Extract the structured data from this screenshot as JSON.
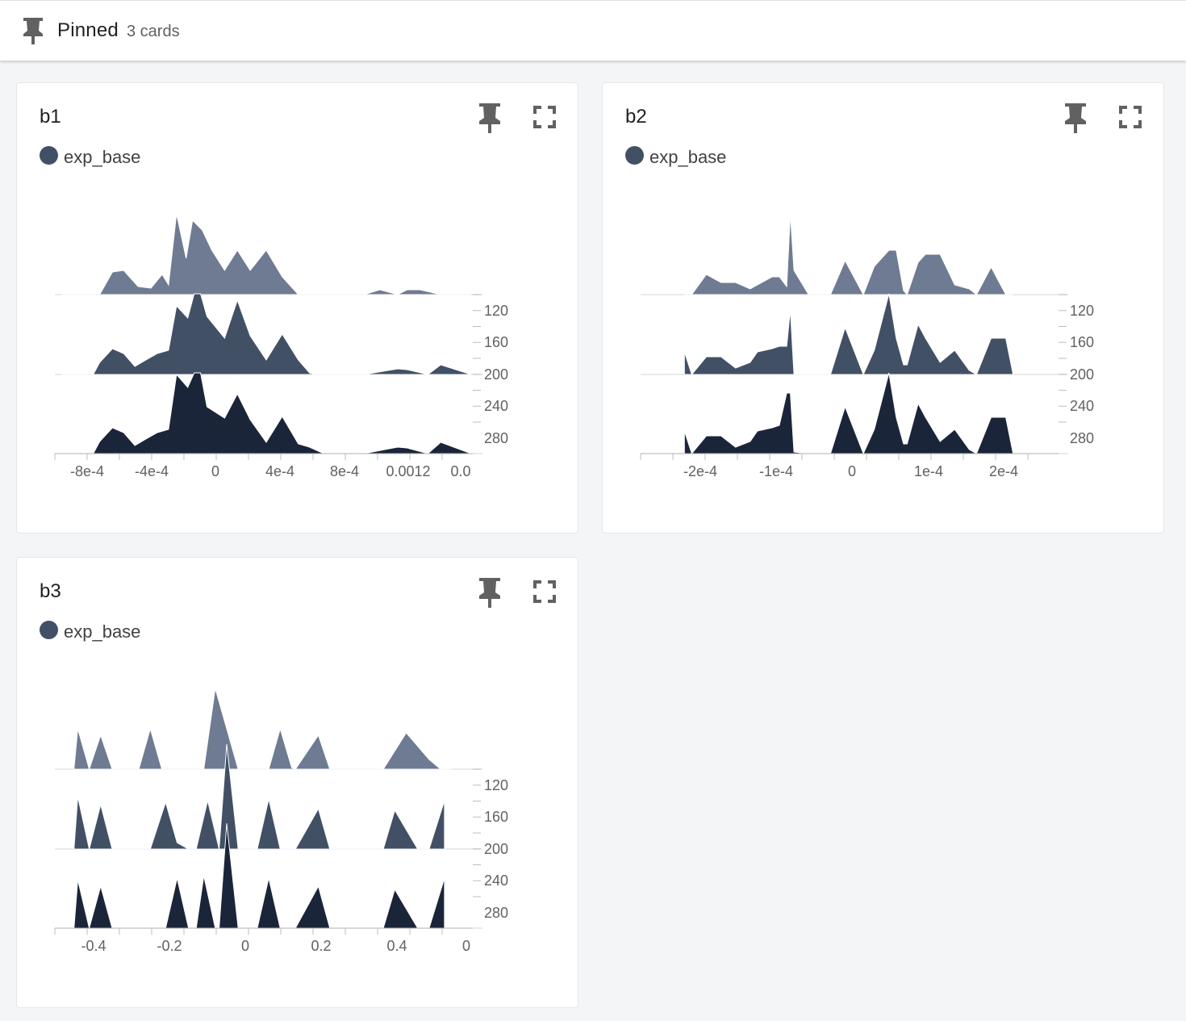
{
  "header": {
    "title": "Pinned",
    "count": "3 cards",
    "icon": "pin-icon"
  },
  "colors": {
    "series": [
      "#6e7b92",
      "#425066",
      "#1b2539"
    ],
    "legend_dot": "#425066"
  },
  "cards": [
    {
      "title": "b1",
      "legend": "exp_base",
      "chart_data": {
        "type": "area",
        "subtype": "histogram-offset",
        "x_ticks": [
          "-8e-4",
          "-4e-4",
          "0",
          "4e-4",
          "8e-4",
          "0.0012",
          "0.0"
        ],
        "y_ticks": [
          "120",
          "160",
          "200",
          "240",
          "280"
        ],
        "series": [
          {
            "x": [
              -0.00096,
              -0.00072,
              -0.00064,
              -0.00057,
              -0.00048,
              -0.0004,
              -0.00033,
              -0.00029,
              -0.00024,
              -0.00018,
              -0.00014,
              -8e-05,
              -2e-05,
              6e-05,
              0.00014,
              0.00022,
              0.00032,
              0.00042,
              0.00052,
              0.00059,
              0.00063,
              0.00093,
              0.00103,
              0.00114,
              0.0012,
              0.00128,
              0.00141,
              0.00143,
              0.0016
            ],
            "y": [
              0,
              0,
              0.28,
              0.3,
              0.1,
              0.08,
              0.25,
              0.12,
              1.0,
              0.45,
              0.92,
              0.8,
              0.55,
              0.3,
              0.55,
              0.3,
              0.55,
              0.22,
              0.0,
              0,
              0,
              0,
              0.06,
              0.0,
              0.06,
              0.06,
              0.0,
              0,
              0
            ]
          },
          {
            "x": [
              -0.00096,
              -0.00076,
              -0.00072,
              -0.00064,
              -0.00057,
              -0.0005,
              -0.00044,
              -0.00036,
              -0.00029,
              -0.00024,
              -0.00017,
              -0.00013,
              -9e-05,
              -5e-05,
              6e-05,
              0.00014,
              0.00022,
              0.00032,
              0.00042,
              0.00052,
              0.00059,
              0.00063,
              0.00093,
              0.00114,
              0.0012,
              0.00133,
              0.00141,
              0.0016
            ],
            "y": [
              0,
              0,
              0.15,
              0.32,
              0.26,
              0.1,
              0.17,
              0.26,
              0.3,
              0.85,
              0.7,
              1.0,
              1.0,
              0.72,
              0.45,
              0.92,
              0.48,
              0.18,
              0.5,
              0.18,
              0.02,
              0,
              0,
              0.07,
              0.06,
              0.0,
              0.12,
              0
            ],
            "y_offset": 1
          },
          {
            "x": [
              -0.00096,
              -0.00076,
              -0.00072,
              -0.00064,
              -0.00057,
              -0.0005,
              -0.00044,
              -0.00036,
              -0.00029,
              -0.00024,
              -0.00017,
              -0.00013,
              -9e-05,
              -5e-05,
              6e-05,
              0.00014,
              0.00022,
              0.00032,
              0.00042,
              0.00052,
              0.00059,
              0.00068,
              0.00093,
              0.00114,
              0.0012,
              0.00133,
              0.00141,
              0.0016
            ],
            "y": [
              0,
              0,
              0.15,
              0.32,
              0.26,
              0.1,
              0.17,
              0.26,
              0.3,
              0.98,
              0.82,
              1.0,
              1.0,
              0.58,
              0.44,
              0.74,
              0.42,
              0.14,
              0.46,
              0.12,
              0.08,
              0.0,
              0,
              0.08,
              0.07,
              0.0,
              0.14,
              0
            ],
            "y_offset": 2
          }
        ],
        "x_range": [
          -0.001,
          0.0016
        ]
      }
    },
    {
      "title": "b2",
      "legend": "exp_base",
      "chart_data": {
        "type": "area",
        "subtype": "histogram-offset",
        "x_ticks": [
          "-2e-4",
          "-1e-4",
          "0",
          "1e-4",
          "2e-4"
        ],
        "y_ticks": [
          "120",
          "160",
          "200",
          "240",
          "280"
        ],
        "series": [
          {
            "x": [
              -0.00025,
              -0.00024,
              -0.00022,
              -0.0002,
              -0.00018,
              -0.00016,
              -0.00015,
              -0.00013,
              -0.00012,
              -0.00011,
              -0.000105,
              -0.0001,
              -8e-05,
              -5e-05,
              -3e-05,
              -5e-06,
              1e-05,
              3e-05,
              4e-05,
              5e-05,
              5.5e-05,
              7e-05,
              8e-05,
              0.0001,
              0.00012,
              0.00014,
              0.00015,
              0.00017,
              0.00019,
              0.0002
            ],
            "y": [
              0,
              0,
              0.25,
              0.15,
              0.15,
              0.07,
              0.12,
              0.22,
              0.22,
              0.1,
              1.0,
              0.3,
              0.0,
              0,
              0.42,
              0.0,
              0.35,
              0.55,
              0.55,
              0.05,
              0,
              0.4,
              0.5,
              0.5,
              0.12,
              0.07,
              0.0,
              0.34,
              0,
              0
            ],
            "y_offset": 0
          },
          {
            "x": [
              -0.00025,
              -0.00024,
              -0.00022,
              -0.0002,
              -0.00018,
              -0.00016,
              -0.00015,
              -0.00013,
              -0.00012,
              -0.00011,
              -0.000105,
              -0.0001,
              -8e-05,
              -5e-05,
              -3e-05,
              -5e-06,
              1e-05,
              3e-05,
              4e-05,
              5e-05,
              5.5e-05,
              7e-05,
              8e-05,
              0.0001,
              0.00012,
              0.00014,
              0.00015,
              0.00017,
              0.00019,
              0.0002
            ],
            "y": [
              0.28,
              0.0,
              0.22,
              0.22,
              0.08,
              0.15,
              0.28,
              0.32,
              0.35,
              0.35,
              0.8,
              0.0,
              0.0,
              0,
              0.58,
              0.0,
              0.3,
              1.0,
              0.45,
              0.12,
              0.12,
              0.62,
              0.45,
              0.15,
              0.3,
              0.05,
              0.0,
              0.45,
              0.45,
              0
            ],
            "y_offset": 1
          },
          {
            "x": [
              -0.00025,
              -0.00024,
              -0.00022,
              -0.0002,
              -0.00018,
              -0.00016,
              -0.00015,
              -0.00013,
              -0.00012,
              -0.00011,
              -0.000105,
              -0.0001,
              -8e-05,
              -5e-05,
              -3e-05,
              -5e-06,
              1e-05,
              3e-05,
              4e-05,
              5e-05,
              5.5e-05,
              7e-05,
              8e-05,
              0.0001,
              0.00012,
              0.00014,
              0.00015,
              0.00017,
              0.00019,
              0.0002
            ],
            "y": [
              0.28,
              0.0,
              0.22,
              0.22,
              0.08,
              0.15,
              0.28,
              0.32,
              0.35,
              0.75,
              0.75,
              0.02,
              0.0,
              0,
              0.58,
              0.0,
              0.3,
              1.0,
              0.45,
              0.12,
              0.12,
              0.62,
              0.45,
              0.15,
              0.3,
              0.05,
              0.0,
              0.45,
              0.45,
              0
            ],
            "y_offset": 2
          }
        ],
        "x_range": [
          -0.00031,
          0.00026
        ]
      }
    },
    {
      "title": "b3",
      "legend": "exp_base",
      "chart_data": {
        "type": "area",
        "subtype": "histogram-offset",
        "x_ticks": [
          "-0.4",
          "-0.2",
          "0",
          "0.2",
          "0.4",
          "0"
        ],
        "y_ticks": [
          "120",
          "160",
          "200",
          "240",
          "280"
        ],
        "series": [
          {
            "x": [
              -0.44,
              -0.43,
              -0.4,
              -0.37,
              -0.34,
              -0.27,
              -0.24,
              -0.21,
              -0.1,
              -0.07,
              -0.04,
              -0.01,
              0.07,
              0.1,
              0.13,
              0.14,
              0.2,
              0.23,
              0.37,
              0.43,
              0.49,
              0.52,
              0.55
            ],
            "y": [
              0,
              0.5,
              0.0,
              0.42,
              0.0,
              0,
              0.5,
              0.0,
              0.0,
              1.0,
              0.5,
              0.0,
              0.0,
              0.5,
              0.02,
              0.0,
              0.42,
              0.0,
              0.0,
              0.45,
              0.12,
              0.0,
              0
            ],
            "y_offset": 0
          },
          {
            "x": [
              -0.44,
              -0.43,
              -0.4,
              -0.37,
              -0.34,
              -0.24,
              -0.2,
              -0.17,
              -0.14,
              -0.12,
              -0.09,
              -0.06,
              -0.04,
              -0.01,
              0.04,
              0.07,
              0.1,
              0.14,
              0.2,
              0.23,
              0.37,
              0.4,
              0.46,
              0.49,
              0.53
            ],
            "y": [
              0,
              0.65,
              0.0,
              0.55,
              0.0,
              0,
              0.58,
              0.08,
              0.0,
              0.0,
              0.6,
              0.0,
              1.3,
              0.0,
              0.0,
              0.62,
              0.0,
              0.0,
              0.5,
              0.0,
              0.0,
              0.48,
              0.0,
              0.0,
              0.6
            ],
            "y_offset": 1
          },
          {
            "x": [
              -0.44,
              -0.43,
              -0.4,
              -0.37,
              -0.34,
              -0.2,
              -0.17,
              -0.14,
              -0.12,
              -0.1,
              -0.07,
              -0.06,
              -0.04,
              -0.01,
              0.04,
              0.07,
              0.1,
              0.14,
              0.2,
              0.23,
              0.37,
              0.4,
              0.46,
              0.49,
              0.53
            ],
            "y": [
              0,
              0.6,
              0.0,
              0.52,
              0.0,
              0,
              0.62,
              0.0,
              0.0,
              0.65,
              0.0,
              0.0,
              1.3,
              0.0,
              0.0,
              0.62,
              0.0,
              0.0,
              0.52,
              0.0,
              0.0,
              0.48,
              0.0,
              0.0,
              0.62
            ],
            "y_offset": 2
          }
        ],
        "x_range": [
          -0.49,
          0.6
        ]
      }
    }
  ],
  "buttons": {
    "pin": "pin-icon",
    "fullscreen": "fullscreen-icon"
  }
}
